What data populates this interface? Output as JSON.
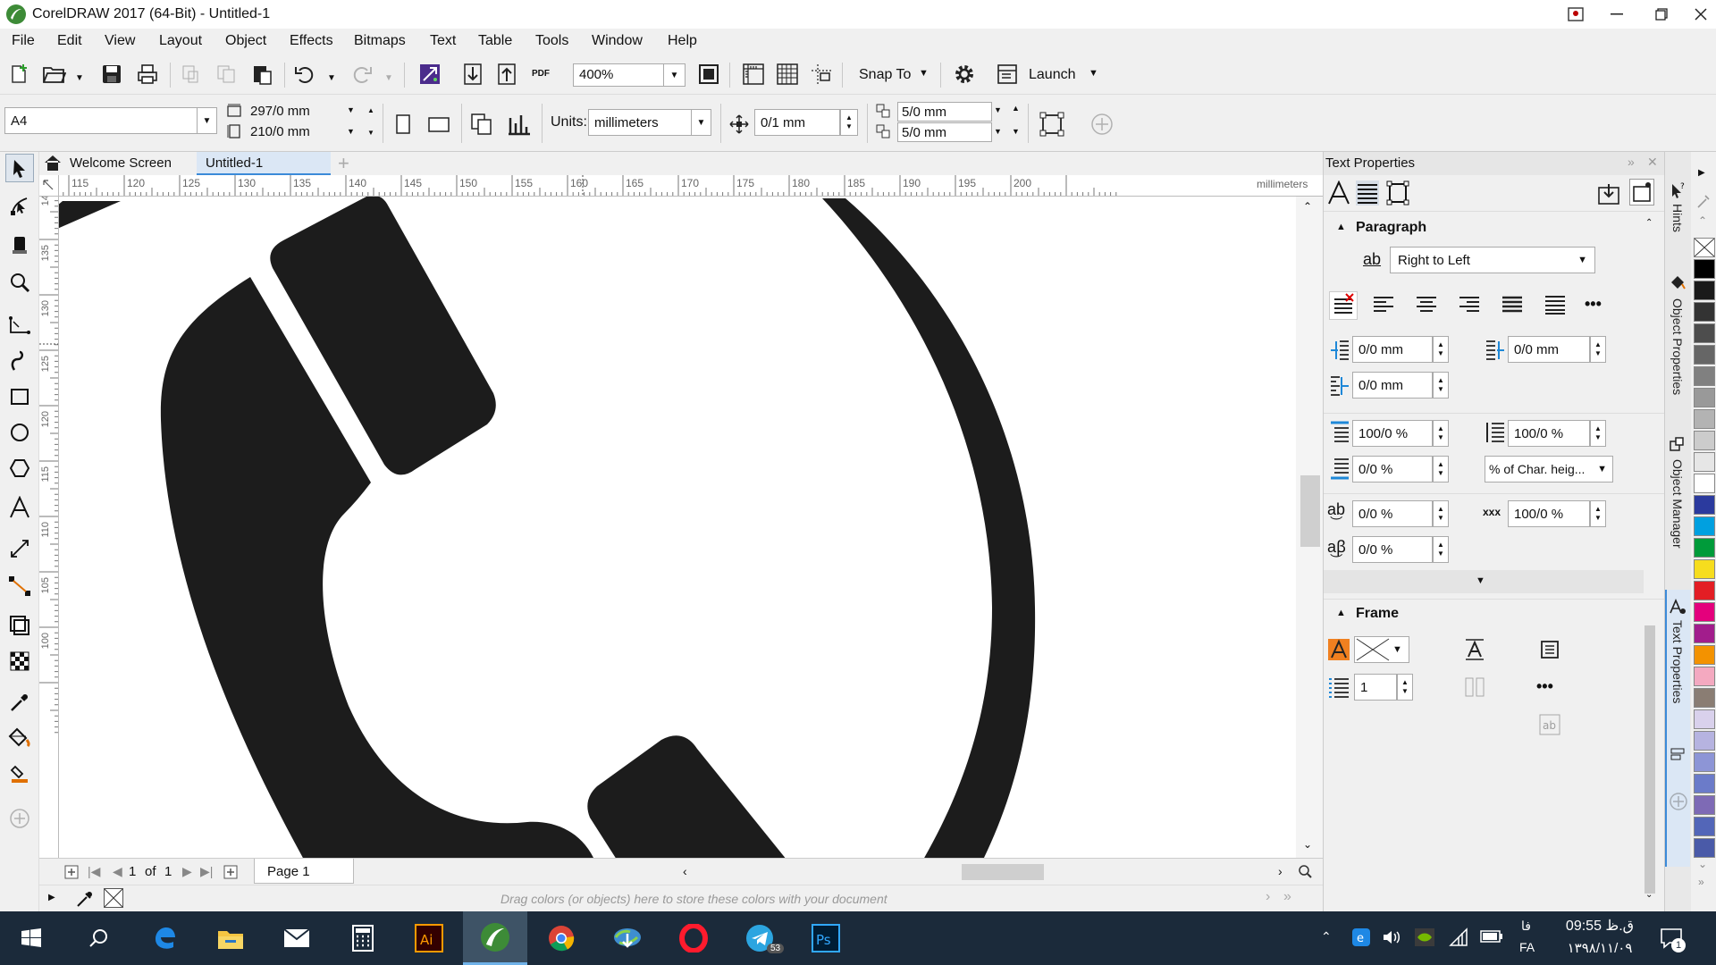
{
  "app": {
    "title": "CorelDRAW 2017 (64-Bit) - Untitled-1"
  },
  "menu": [
    "File",
    "Edit",
    "View",
    "Layout",
    "Object",
    "Effects",
    "Bitmaps",
    "Text",
    "Table",
    "Tools",
    "Window",
    "Help"
  ],
  "toolbar": {
    "zoom": "400%",
    "pdf_label": "PDF",
    "snap_label": "Snap To",
    "launch_label": "Launch"
  },
  "propbar": {
    "page_size": "A4",
    "width": "297/0 mm",
    "height": "210/0 mm",
    "units_label": "Units:",
    "units": "millimeters",
    "nudge": "0/1 mm",
    "dup_x": "5/0 mm",
    "dup_y": "5/0 mm"
  },
  "doc_tabs": {
    "welcome": "Welcome Screen",
    "doc": "Untitled-1"
  },
  "ruler": {
    "h_ticks": [
      "115",
      "120",
      "125",
      "130",
      "135",
      "140",
      "145",
      "150",
      "155",
      "160",
      "165",
      "170",
      "175",
      "180",
      "185",
      "190",
      "195",
      "200"
    ],
    "h_unit": "millimeters",
    "v_ticks": [
      "140",
      "135",
      "130",
      "125",
      "120",
      "115",
      "110",
      "105",
      "100"
    ]
  },
  "page_nav": {
    "current": "1",
    "of": "of",
    "total": "1",
    "page_tab": "Page 1"
  },
  "color_bar": {
    "hint": "Drag colors (or objects) here to store these colors with your document"
  },
  "panel": {
    "title": "Text Properties",
    "paragraph": {
      "header": "Paragraph",
      "direction": "Right to Left",
      "first_indent": "0/0 mm",
      "left_indent": "0/0 mm",
      "right_indent": "0/0 mm",
      "before_spacing": "100/0 %",
      "line_spacing": "100/0 %",
      "after_spacing": "0/0 %",
      "spacing_unit": "% of Char. heig...",
      "char_spacing": "0/0 %",
      "word_spacing": "100/0 %",
      "lang_spacing": "0/0 %"
    },
    "frame": {
      "header": "Frame",
      "columns": "1"
    }
  },
  "side_tabs": [
    "Hints",
    "Object Properties",
    "Object Manager",
    "Text Properties"
  ],
  "palette_colors": [
    "#ffffff",
    "#000000",
    "#1a1a1a",
    "#333333",
    "#4d4d4d",
    "#666666",
    "#808080",
    "#999999",
    "#b3b3b3",
    "#cccccc",
    "#e6e6e6",
    "#ffffff",
    "#2b3a9e",
    "#00a0e0",
    "#009b3a",
    "#f6dd1e",
    "#e31e24",
    "#e4007c",
    "#a21d8c",
    "#f39200",
    "#f4a9c0",
    "#8a7d73",
    "#d9d1ec",
    "#b6b3e0",
    "#8d95d6",
    "#6b7bc9",
    "#7e6ab5",
    "#5366b8",
    "#4a5aa8"
  ],
  "taskbar": {
    "lang": "FA",
    "lang_rtl": "فا",
    "time": "09:55 ق.ظ",
    "date": "۱۳۹۸/۱۱/۰۹",
    "telegram_badge": "53",
    "notif_count": "1"
  }
}
